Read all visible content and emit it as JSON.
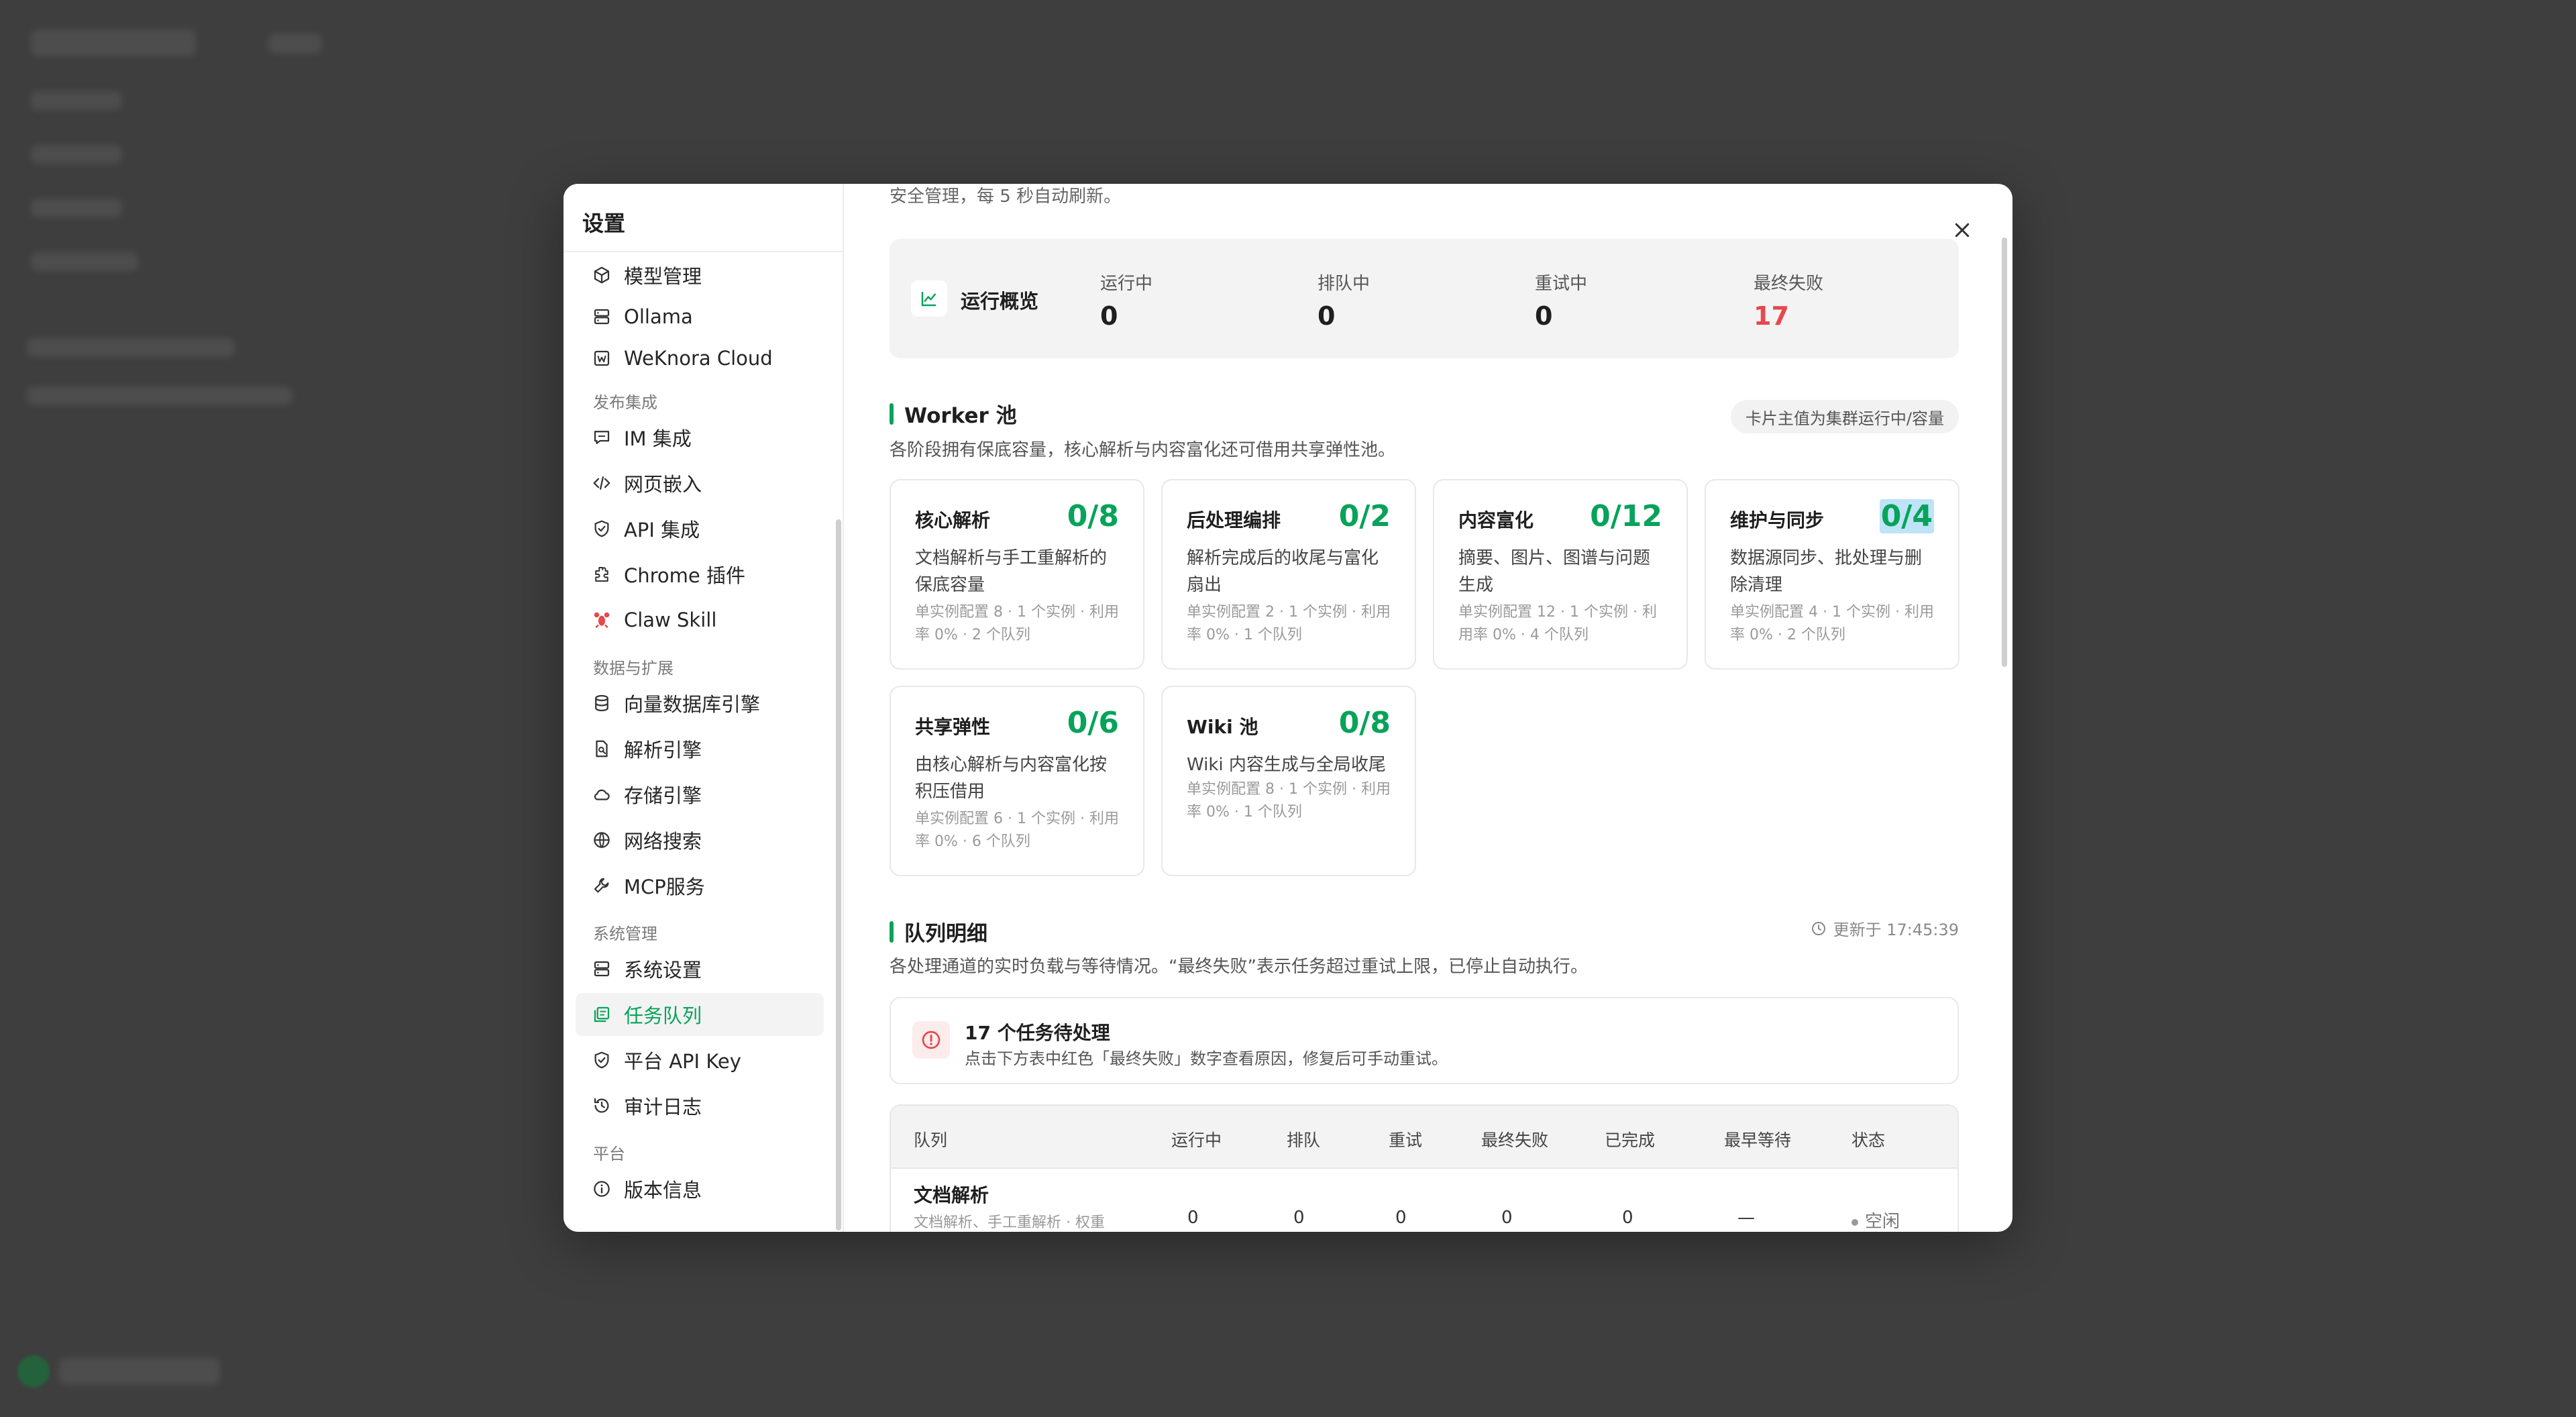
{
  "settings_title": "设置",
  "nav": {
    "items_top": [
      {
        "label": "模型管理",
        "icon": "cube-icon"
      },
      {
        "label": "Ollama",
        "icon": "server-icon"
      },
      {
        "label": "WeKnora Cloud",
        "icon": "w-logo-icon"
      }
    ],
    "group_publish": "发布集成",
    "items_publish": [
      {
        "label": "IM 集成",
        "icon": "chat-icon"
      },
      {
        "label": "网页嵌入",
        "icon": "code-icon"
      },
      {
        "label": "API 集成",
        "icon": "shield-icon"
      },
      {
        "label": "Chrome 插件",
        "icon": "puzzle-icon"
      },
      {
        "label": "Claw Skill",
        "icon": "lobster-icon"
      }
    ],
    "group_data": "数据与扩展",
    "items_data": [
      {
        "label": "向量数据库引擎",
        "icon": "database-icon"
      },
      {
        "label": "解析引擎",
        "icon": "file-search-icon"
      },
      {
        "label": "存储引擎",
        "icon": "cloud-icon"
      },
      {
        "label": "网络搜索",
        "icon": "globe-icon"
      },
      {
        "label": "MCP服务",
        "icon": "wrench-icon"
      }
    ],
    "group_system": "系统管理",
    "items_system": [
      {
        "label": "系统设置",
        "icon": "server-icon"
      },
      {
        "label": "任务队列",
        "icon": "queue-icon",
        "active": true
      },
      {
        "label": "平台 API Key",
        "icon": "shield-icon"
      },
      {
        "label": "审计日志",
        "icon": "history-icon"
      }
    ],
    "group_platform": "平台",
    "items_platform": [
      {
        "label": "版本信息",
        "icon": "info-icon"
      }
    ]
  },
  "top_desc": "安全管理，每 5 秒自动刷新。",
  "overview": {
    "title": "运行概览",
    "stats": [
      {
        "label": "运行中",
        "value": "0"
      },
      {
        "label": "排队中",
        "value": "0"
      },
      {
        "label": "重试中",
        "value": "0"
      },
      {
        "label": "最终失败",
        "value": "17"
      }
    ]
  },
  "worker_pool": {
    "title": "Worker 池",
    "chip": "卡片主值为集群运行中/容量",
    "desc": "各阶段拥有保底容量，核心解析与内容富化还可借用共享弹性池。",
    "cards": [
      {
        "name": "核心解析",
        "value": "0/8",
        "desc": "文档解析与手工重解析的保底容量",
        "meta": "单实例配置 8 · 1 个实例 · 利用率 0% · 2 个队列"
      },
      {
        "name": "后处理编排",
        "value": "0/2",
        "desc": "解析完成后的收尾与富化扇出",
        "meta": "单实例配置 2 · 1 个实例 · 利用率 0% · 1 个队列"
      },
      {
        "name": "内容富化",
        "value": "0/12",
        "desc": "摘要、图片、图谱与问题生成",
        "meta": "单实例配置 12 · 1 个实例 · 利用率 0% · 4 个队列"
      },
      {
        "name": "维护与同步",
        "value": "0/4",
        "desc": "数据源同步、批处理与删除清理",
        "meta": "单实例配置 4 · 1 个实例 · 利用率 0% · 2 个队列"
      },
      {
        "name": "共享弹性",
        "value": "0/6",
        "desc": "由核心解析与内容富化按积压借用",
        "meta": "单实例配置 6 · 1 个实例 · 利用率 0% · 6 个队列"
      },
      {
        "name": "Wiki 池",
        "value": "0/8",
        "desc": "Wiki 内容生成与全局收尾",
        "meta": "单实例配置 8 · 1 个实例 · 利用率 0% · 1 个队列"
      }
    ]
  },
  "queue_detail": {
    "title": "队列明细",
    "updated": "更新于 17:45:39",
    "desc": "各处理通道的实时负载与等待情况。“最终失败”表示任务超过重试上限，已停止自动执行。",
    "alert_title": "17 个任务待处理",
    "alert_desc": "点击下方表中红色「最终失败」数字查看原因，修复后可手动重试。",
    "columns": [
      "队列",
      "运行中",
      "排队",
      "重试",
      "最终失败",
      "已完成",
      "最早等待",
      "状态"
    ],
    "rows": [
      {
        "name": "文档解析",
        "sub": "文档解析、手工重解析 · 权重",
        "running": "0",
        "queued": "0",
        "retry": "0",
        "failed": "0",
        "done": "0",
        "oldest": "—",
        "status": "空闲"
      }
    ]
  }
}
